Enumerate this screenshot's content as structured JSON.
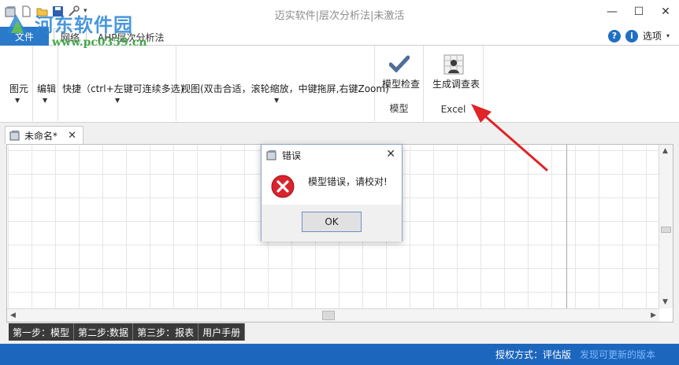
{
  "window": {
    "title": "迈实软件|层次分析法|未激活",
    "minimize_glyph": "—",
    "maximize_glyph": "☐",
    "close_glyph": "✕"
  },
  "watermark": {
    "site_name": "河东软件园",
    "url": "www.pc0359.cn"
  },
  "ribbon_tabs": {
    "file": "文件",
    "tabs": [
      "网络",
      "AHP层次分析法"
    ],
    "options_label": "选项"
  },
  "ribbon": {
    "groups": [
      {
        "label": "图元"
      },
      {
        "label": "编辑"
      },
      {
        "label": "快捷（ctrl+左键可连续多选)"
      },
      {
        "label": "视图(双击合适，滚轮缩放，中键拖屏,右键Zoom)"
      }
    ],
    "model_check": {
      "label": "模型检查",
      "group": "模型"
    },
    "generate_survey": {
      "label": "生成调查表",
      "group": "Excel"
    }
  },
  "document_tab": {
    "label": "未命名*"
  },
  "dialog": {
    "title": "错误",
    "message": "模型错误，请校对!",
    "ok_label": "OK"
  },
  "steps": [
    "第一步：模型",
    "第二步:数据",
    "第三步：报表",
    "用户手册"
  ],
  "status": {
    "auth": "授权方式：评估版",
    "update_link": "发现可更新的版本"
  },
  "colors": {
    "accent": "#1d66bd",
    "file_tab": "#2b79c9",
    "error_red": "#d9232d",
    "arrow_red": "#e0242a"
  }
}
